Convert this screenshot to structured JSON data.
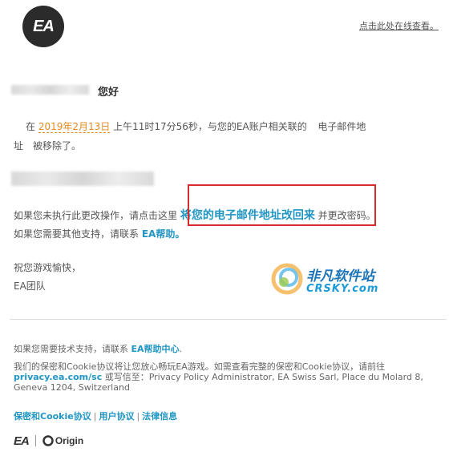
{
  "header": {
    "logo_text": "EA",
    "online_link": "点击此处在线查看。"
  },
  "greeting": "您好",
  "notice": {
    "prefix": "在",
    "date": "2019年2月13日",
    "time_text": "上午11时17分56秒，与您的EA账户相关联的",
    "line1_tail": "电子邮件地",
    "line2": "址　被移除了。"
  },
  "action": {
    "part1": "如果您未执行此更改操作，请点击这里",
    "link": "将您的电子邮件地址改回来",
    "part2": "并更改密码。"
  },
  "support": {
    "text": "如果您需要其他支持，请联系",
    "link": "EA帮助。"
  },
  "signoff": {
    "line1": "祝您游戏愉快，",
    "line2": "EA团队"
  },
  "watermark": {
    "line1": "非凡软件站",
    "line2": "CRSKY.com"
  },
  "footer": {
    "tech_support_text": "如果您需要技术支持，请联系",
    "tech_support_link": "EA帮助中心",
    "tech_support_end": ".",
    "privacy_text1": "我们的保密和Cookie协议将让您放心畅玩EA游戏。如需查看完整的保密和Cookie协议，请前往",
    "privacy_link": "privacy.ea.com/sc",
    "privacy_text2": "或写信至：Privacy Policy Administrator, EA Swiss Sarl, Place du Molard 8,",
    "privacy_text3": "Geneva 1204, Switzerland",
    "legal_links": [
      "保密和Cookie协议",
      "用户协议",
      "法律信息"
    ],
    "separator": "|",
    "brand_ea": "EA",
    "brand_origin": "Origin"
  },
  "colors": {
    "accent": "#2196c4",
    "date": "#e38a1d",
    "highlight_box": "#d92b2b"
  }
}
